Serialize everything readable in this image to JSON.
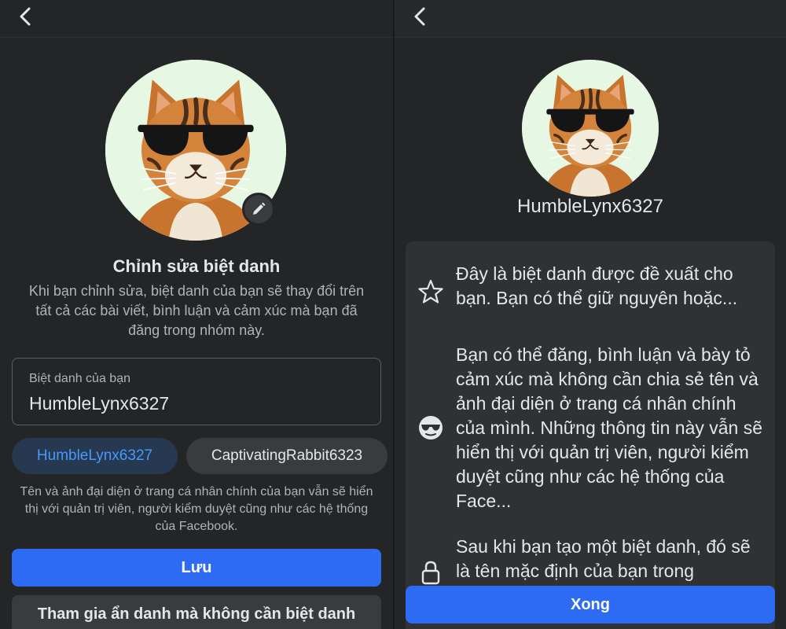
{
  "left": {
    "title": "Chỉnh sửa biệt danh",
    "subtitle": "Khi bạn chỉnh sửa, biệt danh của bạn sẽ thay đổi trên tất cả các bài viết, bình luận và cảm xúc mà bạn đã đăng trong nhóm này.",
    "input": {
      "label": "Biệt danh của bạn",
      "value": "HumbleLynx6327"
    },
    "suggestions": [
      {
        "label": "HumbleLynx6327",
        "selected": true
      },
      {
        "label": "CaptivatingRabbit6323",
        "selected": false
      }
    ],
    "note": "Tên và ảnh đại diện ở trang cá nhân chính của bạn vẫn sẽ hiển thị với quản trị viên, người kiểm duyệt cũng như các hệ thống của Facebook.",
    "save_label": "Lưu",
    "anonymous_label": "Tham gia ẩn danh mà không cần biệt danh"
  },
  "right": {
    "username": "HumbleLynx6327",
    "items": [
      {
        "icon": "star-icon",
        "text": "Đây là biệt danh được đề xuất cho bạn. Bạn có thể giữ nguyên hoặc..."
      },
      {
        "icon": "sunglasses-icon",
        "text": "Bạn có thể đăng, bình luận và bày tỏ cảm xúc mà không cần chia sẻ tên và ảnh đại diện ở trang cá nhân chính của mình. Những thông tin này vẫn sẽ hiển thị với quản trị viên, người kiểm duyệt cũng như các hệ thống của Face..."
      },
      {
        "icon": "lock-icon",
        "text": "Sau khi bạn tạo một biệt danh, đó sẽ là tên mặc định của bạn trong"
      }
    ],
    "done_label": "Xong"
  },
  "colors": {
    "background": "#242526",
    "card": "#303132",
    "primary": "#2d6bf5",
    "chip_selected_bg": "#263951",
    "chip_selected_text": "#4599ff",
    "text_primary": "#e4e6eb",
    "text_secondary": "#b0b3b8"
  }
}
